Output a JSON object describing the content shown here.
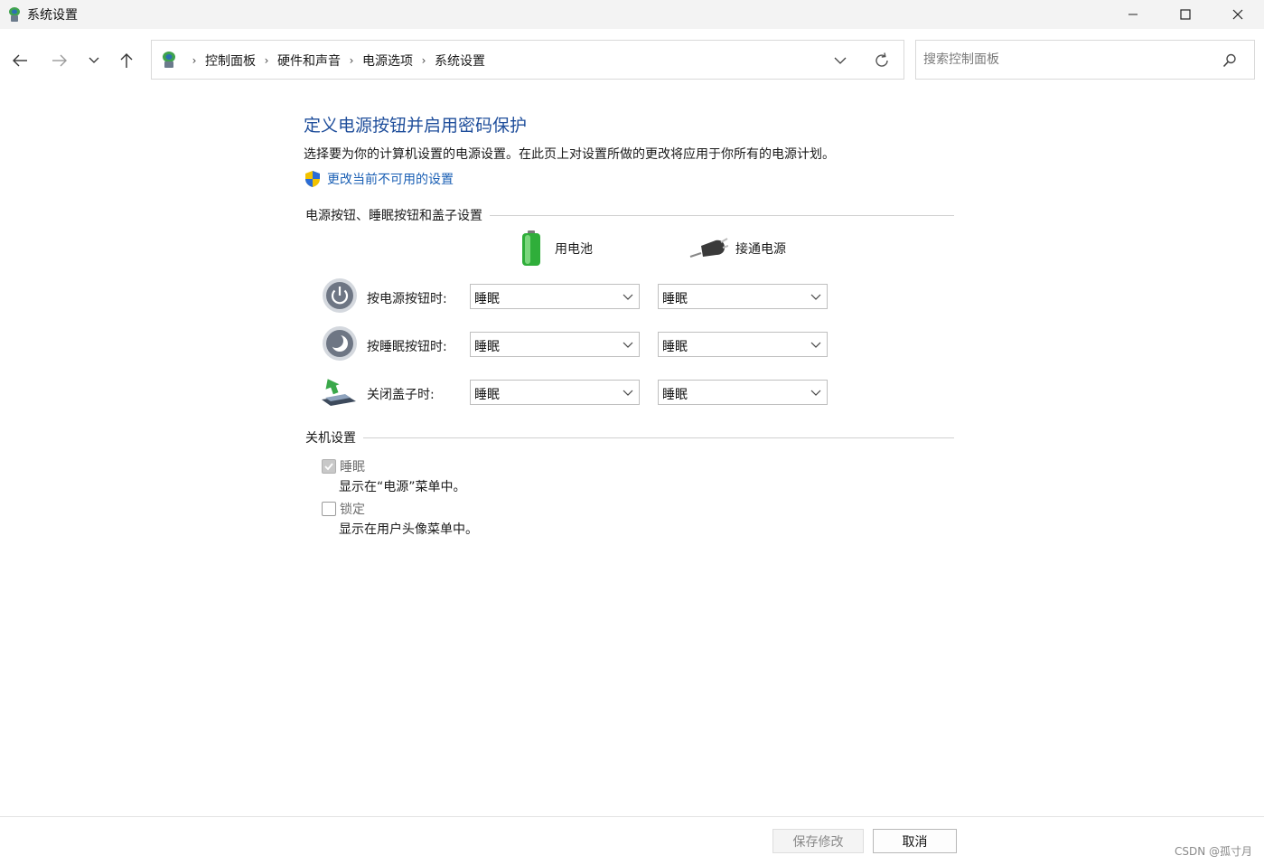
{
  "window": {
    "title": "系统设置",
    "app_icon": "control-panel-icon",
    "controls": [
      "minimize-icon",
      "maximize-icon",
      "close-icon"
    ]
  },
  "nav": {
    "breadcrumbs": [
      "控制面板",
      "硬件和声音",
      "电源选项",
      "系统设置"
    ],
    "search_placeholder": "搜索控制面板"
  },
  "main": {
    "title": "定义电源按钮并启用密码保护",
    "description": "选择要为你的计算机设置的电源设置。在此页上对设置所做的更改将应用于你所有的电源计划。",
    "change_link": "更改当前不可用的设置",
    "power_section": {
      "heading": "电源按钮、睡眠按钮和盖子设置",
      "columns": [
        "用电池",
        "接通电源"
      ],
      "rows": [
        {
          "label": "按电源按钮时:",
          "icon": "power-button-icon",
          "battery": "睡眠",
          "plugged": "睡眠"
        },
        {
          "label": "按睡眠按钮时:",
          "icon": "sleep-button-icon",
          "battery": "睡眠",
          "plugged": "睡眠"
        },
        {
          "label": "关闭盖子时:",
          "icon": "laptop-lid-icon",
          "battery": "睡眠",
          "plugged": "睡眠"
        }
      ]
    },
    "shutdown_section": {
      "heading": "关机设置",
      "options": [
        {
          "label": "睡眠",
          "description": "显示在“电源”菜单中。",
          "checked": true,
          "disabled": true
        },
        {
          "label": "锁定",
          "description": "显示在用户头像菜单中。",
          "checked": false,
          "disabled": true
        }
      ]
    }
  },
  "footer": {
    "save_label": "保存修改",
    "cancel_label": "取消"
  },
  "watermark": "CSDN @孤寸月",
  "colors": {
    "title_blue": "#1f4e9b",
    "link_blue": "#1a5fb4",
    "titlebar_bg": "#f3f3f3"
  }
}
